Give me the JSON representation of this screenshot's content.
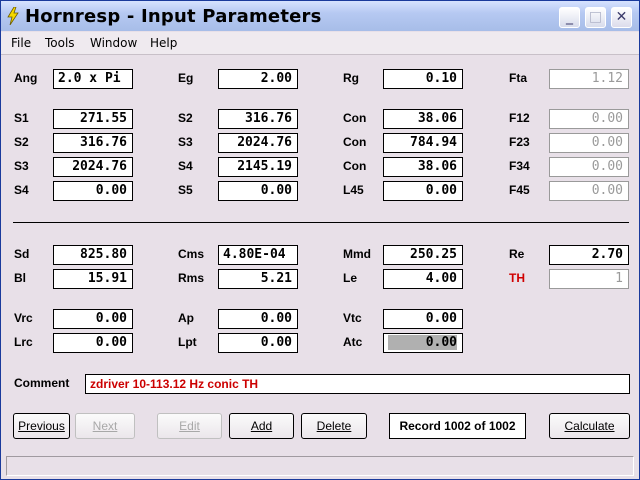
{
  "title": "Hornresp - Input Parameters",
  "window_controls": {
    "minimize": "_",
    "maximize": "□",
    "close": "✕"
  },
  "menu": [
    "File",
    "Tools",
    "Window",
    "Help"
  ],
  "row1": {
    "ang": {
      "label": "Ang",
      "value": "2.0 x Pi"
    },
    "eg": {
      "label": "Eg",
      "value": "2.00"
    },
    "rg": {
      "label": "Rg",
      "value": "0.10"
    },
    "fta": {
      "label": "Fta",
      "value": "1.12"
    }
  },
  "horn_rows": [
    {
      "a": {
        "label": "S1",
        "value": "271.55"
      },
      "b": {
        "label": "S2",
        "value": "316.76"
      },
      "c": {
        "label": "Con",
        "value": "38.06"
      },
      "d": {
        "label": "F12",
        "value": "0.00"
      }
    },
    {
      "a": {
        "label": "S2",
        "value": "316.76"
      },
      "b": {
        "label": "S3",
        "value": "2024.76"
      },
      "c": {
        "label": "Con",
        "value": "784.94"
      },
      "d": {
        "label": "F23",
        "value": "0.00"
      }
    },
    {
      "a": {
        "label": "S3",
        "value": "2024.76"
      },
      "b": {
        "label": "S4",
        "value": "2145.19"
      },
      "c": {
        "label": "Con",
        "value": "38.06"
      },
      "d": {
        "label": "F34",
        "value": "0.00"
      }
    },
    {
      "a": {
        "label": "S4",
        "value": "0.00"
      },
      "b": {
        "label": "S5",
        "value": "0.00"
      },
      "c": {
        "label": "L45",
        "value": "0.00"
      },
      "d": {
        "label": "F45",
        "value": "0.00"
      }
    }
  ],
  "driver": {
    "sd": {
      "label": "Sd",
      "value": "825.80"
    },
    "cms": {
      "label": "Cms",
      "value": "4.80E-04"
    },
    "mmd": {
      "label": "Mmd",
      "value": "250.25"
    },
    "re": {
      "label": "Re",
      "value": "2.70"
    },
    "bl": {
      "label": "Bl",
      "value": "15.91"
    },
    "rms": {
      "label": "Rms",
      "value": "5.21"
    },
    "le": {
      "label": "Le",
      "value": "4.00"
    },
    "th": {
      "label": "TH",
      "value": "1"
    }
  },
  "chambers": {
    "vrc": {
      "label": "Vrc",
      "value": "0.00"
    },
    "ap": {
      "label": "Ap",
      "value": "0.00"
    },
    "vtc": {
      "label": "Vtc",
      "value": "0.00"
    },
    "lrc": {
      "label": "Lrc",
      "value": "0.00"
    },
    "lpt": {
      "label": "Lpt",
      "value": "0.00"
    },
    "atc": {
      "label": "Atc",
      "value": "0.00"
    }
  },
  "comment": {
    "label": "Comment",
    "value": "zdriver 10-113.12 Hz conic TH"
  },
  "buttons": {
    "previous": "Previous",
    "next": "Next",
    "edit": "Edit",
    "add": "Add",
    "delete": "Delete",
    "calculate": "Calculate"
  },
  "record": "Record 1002 of 1002",
  "colors": {
    "title_bar": "#b6c9f2",
    "window_bg": "#e8e0e8",
    "comment_text": "#cc0000",
    "th_label": "#d00000"
  }
}
